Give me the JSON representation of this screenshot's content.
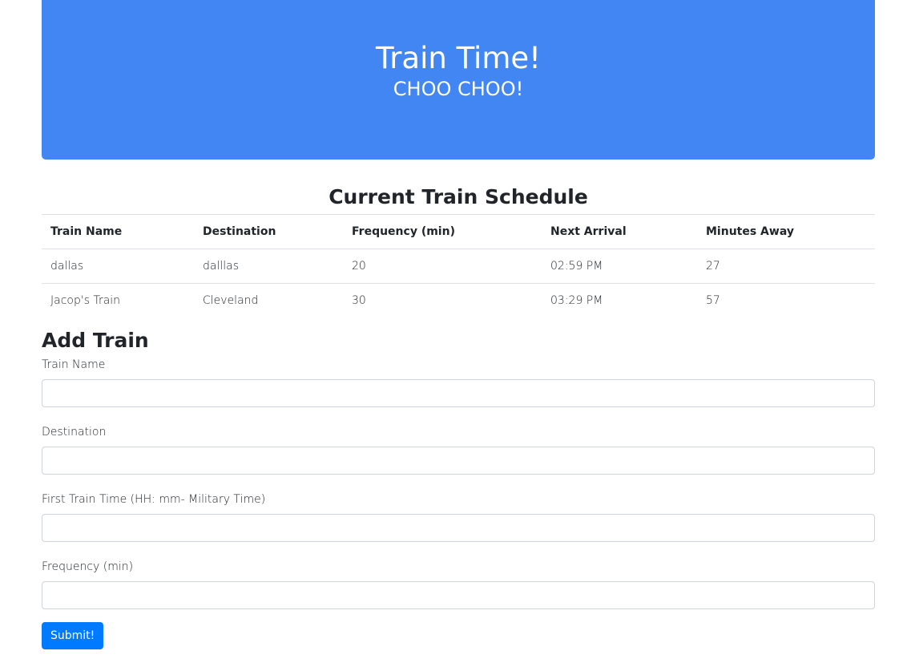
{
  "header": {
    "title": "Train Time!",
    "subtitle": "CHOO CHOO!",
    "background_color": "#4286f4"
  },
  "schedule": {
    "title": "Current Train Schedule",
    "columns": [
      "Train Name",
      "Destination",
      "Frequency (min)",
      "Next Arrival",
      "Minutes Away"
    ],
    "rows": [
      [
        "dallas",
        "dalllas",
        "20",
        "02:59 PM",
        "27"
      ],
      [
        "Jacop's Train",
        "Cleveland",
        "30",
        "03:29 PM",
        "57"
      ]
    ]
  },
  "form": {
    "title": "Add Train",
    "fields": [
      {
        "label": "Train Name",
        "value": ""
      },
      {
        "label": "Destination",
        "value": ""
      },
      {
        "label": "First Train Time (HH: mm- Military Time)",
        "value": ""
      },
      {
        "label": "Frequency (min)",
        "value": ""
      }
    ],
    "submit_label": "Submit!",
    "submit_color": "#007bff"
  }
}
